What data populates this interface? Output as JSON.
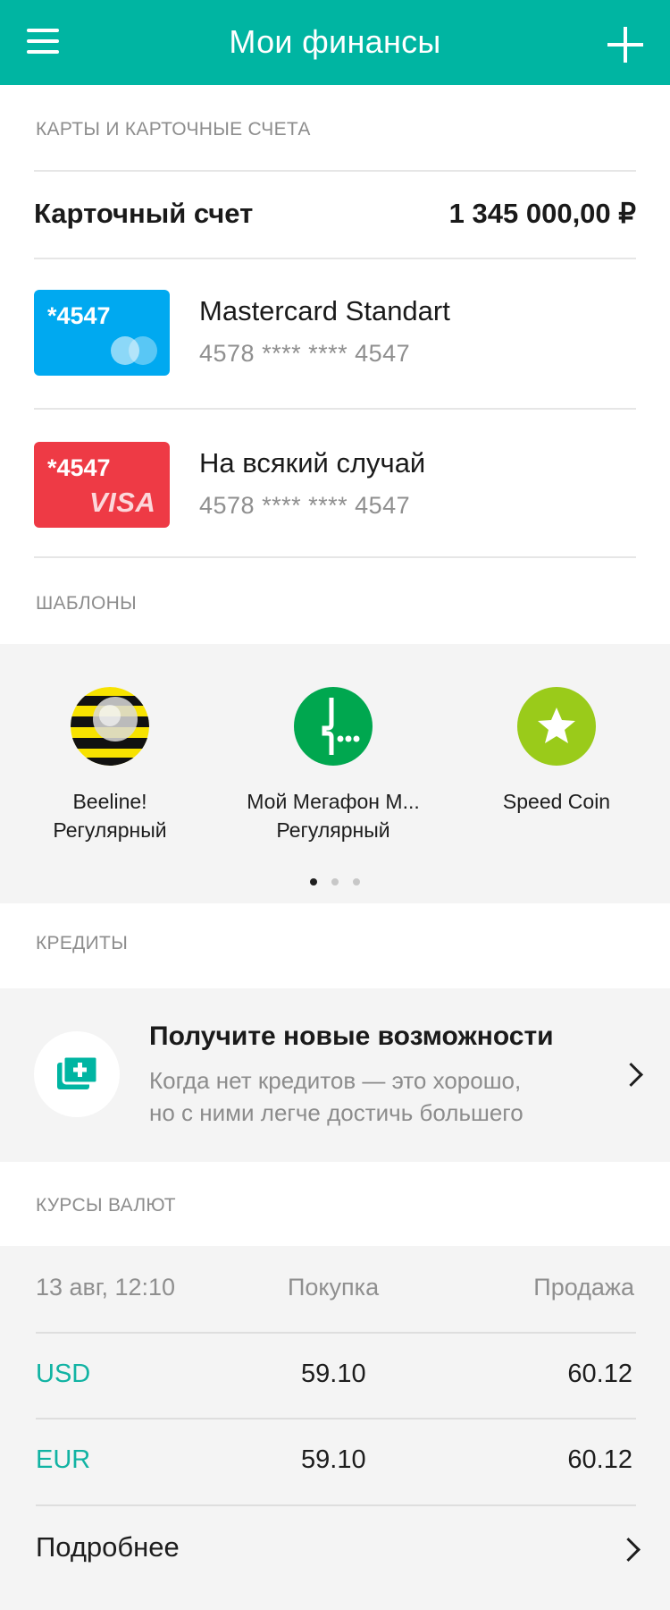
{
  "header": {
    "title": "Мои финансы",
    "menu_icon": "hamburger-menu-icon",
    "add_icon": "plus-icon"
  },
  "cards_section": {
    "label": "КАРТЫ И КАРТОЧНЫЕ СЧЕТА",
    "account": {
      "name": "Карточный счет",
      "balance": "1 345 000,00 ₽"
    },
    "cards": [
      {
        "badge": "*4547",
        "brand": "mastercard",
        "title": "Mastercard Standart",
        "number": "4578 **** **** 4547",
        "color": "#00a9f0"
      },
      {
        "badge": "*4547",
        "brand": "VISA",
        "title": "На всякий случай",
        "number": "4578 **** **** 4547",
        "color": "#ee3a45"
      }
    ]
  },
  "templates_section": {
    "label": "ШАБЛОНЫ",
    "items": [
      {
        "line1": "Beeline!",
        "line2": "Регулярный",
        "icon": "beeline-logo-icon"
      },
      {
        "line1": "Мой Мегафон М...",
        "line2": "Регулярный",
        "icon": "megafon-logo-icon",
        "color": "#00a74f"
      },
      {
        "line1": "Speed Coin",
        "line2": "",
        "icon": "star-icon",
        "color": "#9acb1a"
      }
    ],
    "pager": {
      "pages": 3,
      "current": 1
    }
  },
  "credits_section": {
    "label": "КРЕДИТЫ",
    "promo": {
      "title": "Получите новые возможности",
      "text_line1": "Когда нет кредитов — это хорошо,",
      "text_line2": "но с ними легче достичь большего",
      "icon": "add-credit-icon"
    }
  },
  "rates_section": {
    "label": "КУРСЫ ВАЛЮТ",
    "header": {
      "date": "13 авг, 12:10",
      "buy": "Покупка",
      "sell": "Продажа"
    },
    "rows": [
      {
        "code": "USD",
        "buy": "59.10",
        "sell": "60.12"
      },
      {
        "code": "EUR",
        "buy": "59.10",
        "sell": "60.12"
      }
    ],
    "more_label": "Подробнее"
  },
  "colors": {
    "accent": "#00b5a2",
    "rate_code": "#11b3a3"
  }
}
